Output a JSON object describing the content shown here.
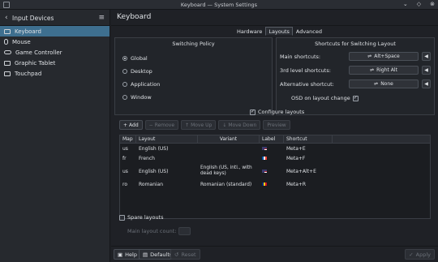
{
  "window": {
    "title": "Keyboard — System Settings"
  },
  "sidebar": {
    "header": "Input Devices",
    "items": [
      {
        "label": "Keyboard",
        "icon": "keyboard-icon",
        "active": true
      },
      {
        "label": "Mouse",
        "icon": "mouse-icon"
      },
      {
        "label": "Game Controller",
        "icon": "game-controller-icon"
      },
      {
        "label": "Graphic Tablet",
        "icon": "graphic-tablet-icon"
      },
      {
        "label": "Touchpad",
        "icon": "touchpad-icon"
      }
    ]
  },
  "main": {
    "title": "Keyboard",
    "tabs": [
      {
        "label": "Hardware"
      },
      {
        "label": "Layouts",
        "active": true
      },
      {
        "label": "Advanced"
      }
    ]
  },
  "switching_policy": {
    "title": "Switching Policy",
    "options": [
      "Global",
      "Desktop",
      "Application",
      "Window"
    ],
    "selected": "Global"
  },
  "shortcuts": {
    "title": "Shortcuts for Switching Layout",
    "rows": [
      {
        "label": "Main shortcuts:",
        "value": "Alt+Space"
      },
      {
        "label": "3rd level shortcuts:",
        "value": "Right Alt"
      },
      {
        "label": "Alternative shortcut:",
        "value": "None"
      }
    ],
    "osd_label": "OSD on layout change",
    "osd_checked": true
  },
  "configure_layouts": {
    "label": "Configure layouts",
    "checked": true
  },
  "toolbar": {
    "add": "Add",
    "remove": "Remove",
    "move_up": "Move Up",
    "move_down": "Move Down",
    "preview": "Preview"
  },
  "layout_table": {
    "headers": [
      "Map",
      "Layout",
      "Variant",
      "Label",
      "Shortcut"
    ],
    "rows": [
      {
        "map": "us",
        "layout": "English (US)",
        "variant": "",
        "flag": "us",
        "shortcut": "Meta+E"
      },
      {
        "map": "fr",
        "layout": "French",
        "variant": "",
        "flag": "fr",
        "shortcut": "Meta+F"
      },
      {
        "map": "us",
        "layout": "English (US)",
        "variant": "English (US, intl., with dead keys)",
        "flag": "us",
        "shortcut": "Meta+Alt+E"
      },
      {
        "map": "ro",
        "layout": "Romanian",
        "variant": "Romanian (standard)",
        "flag": "ro",
        "shortcut": "Meta+R"
      }
    ]
  },
  "spare_layouts": {
    "label": "Spare layouts",
    "checked": false,
    "count_label": "Main layout count:"
  },
  "footer": {
    "help": "Help",
    "defaults": "Defaults",
    "reset": "Reset",
    "apply": "Apply"
  },
  "colors": {
    "accent": "#3e6f8f",
    "background": "#1f2126"
  }
}
